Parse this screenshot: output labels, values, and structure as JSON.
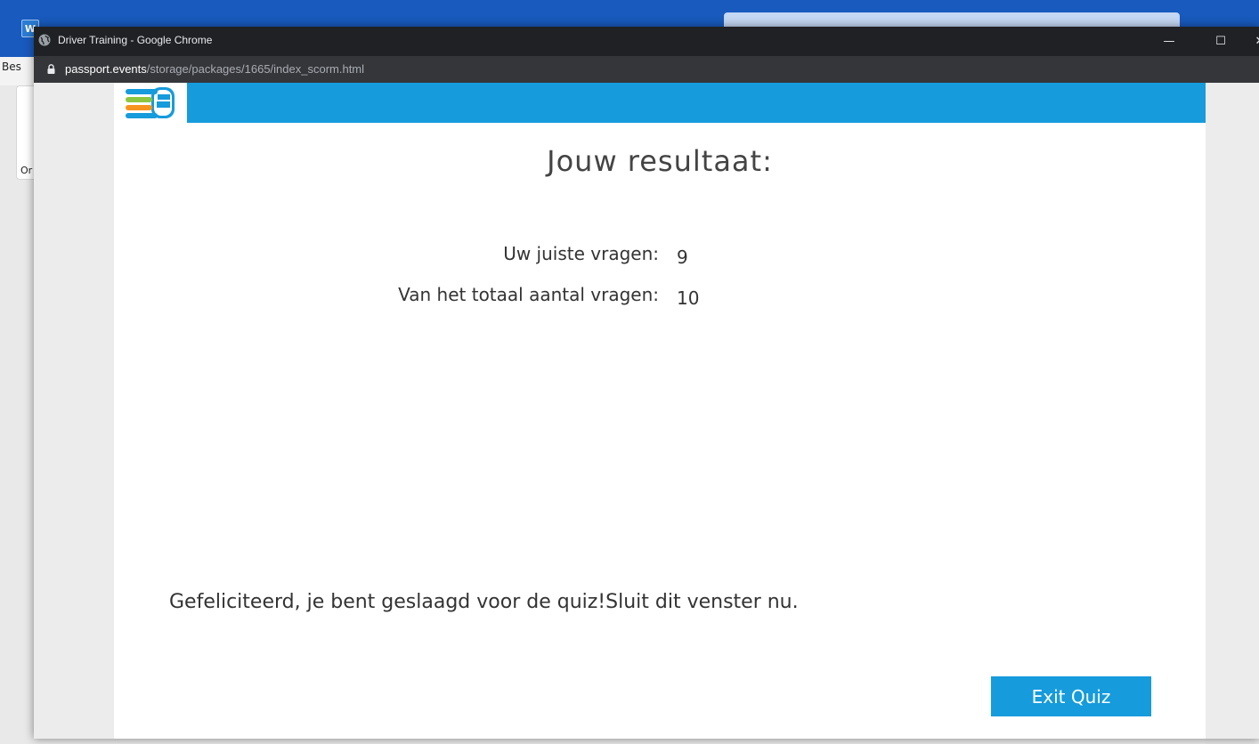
{
  "background_app": {
    "icon_letter": "W",
    "ribbon_text": "Bes",
    "card_text": "Or"
  },
  "window": {
    "title": "Driver Training - Google Chrome",
    "url_domain": "passport.events",
    "url_path": "/storage/packages/1665/index_scorm.html",
    "minimize_glyph": "—",
    "maximize_glyph": "☐",
    "close_glyph": "✕"
  },
  "quiz": {
    "logo_icon": "safe-use-logo",
    "title": "Jouw resultaat:",
    "correct_label": "Uw juiste vragen:",
    "correct_value": "9",
    "total_label": "Van het totaal aantal vragen:",
    "total_value": "10",
    "message": "Gefeliciteerd, je bent geslaagd voor de quiz!Sluit dit venster nu.",
    "exit_label": "Exit Quiz"
  },
  "colors": {
    "accent_blue": "#169bdc",
    "chrome_dark": "#202124",
    "word_blue": "#185abd"
  }
}
